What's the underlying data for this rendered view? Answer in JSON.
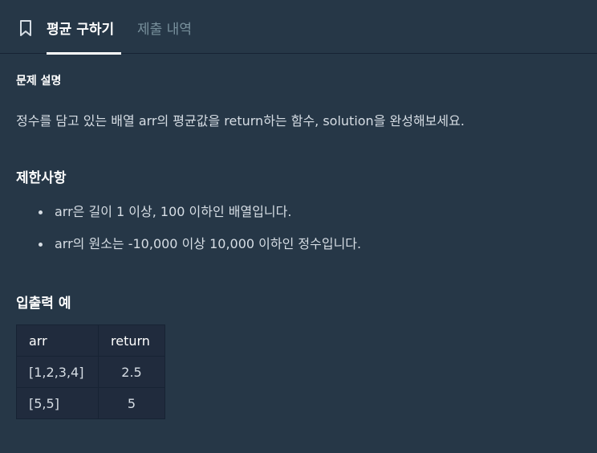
{
  "tabs": {
    "active_label": "평균 구하기",
    "inactive_label": "제출 내역"
  },
  "description": {
    "title": "문제 설명",
    "text": "정수를 담고 있는 배열 arr의 평균값을 return하는 함수, solution을 완성해보세요."
  },
  "limits": {
    "title": "제한사항",
    "items": [
      "arr은 길이 1 이상, 100 이하인 배열입니다.",
      "arr의 원소는 -10,000 이상 10,000 이하인 정수입니다."
    ]
  },
  "io_example": {
    "title": "입출력 예",
    "headers": [
      "arr",
      "return"
    ],
    "rows": [
      [
        "[1,2,3,4]",
        "2.5"
      ],
      [
        "[5,5]",
        "5"
      ]
    ]
  },
  "icons": {
    "bookmark": "bookmark-icon"
  },
  "colors": {
    "background": "#263747",
    "table_background": "#202b3d",
    "border": "#172334",
    "active_tab_text": "#ffffff",
    "inactive_tab_text": "#78909c",
    "body_text": "#d6dde4"
  }
}
